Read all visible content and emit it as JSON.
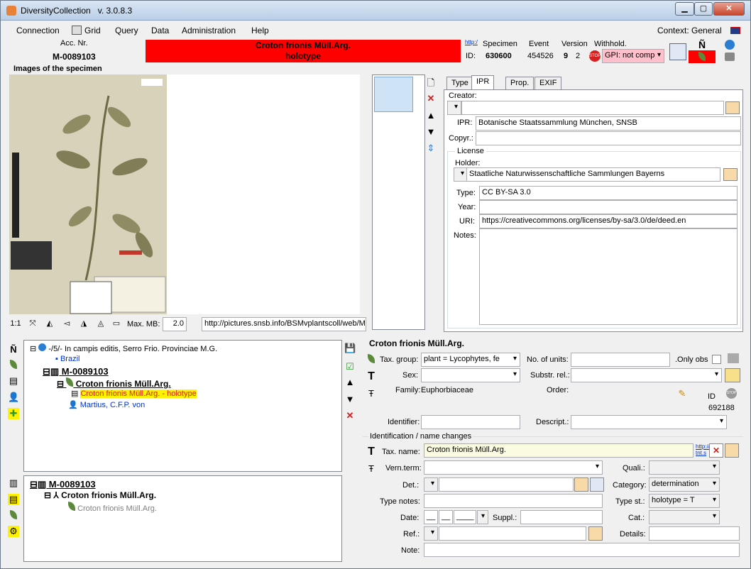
{
  "window": {
    "title": "DiversityCollection",
    "version": "v. 3.0.8.3"
  },
  "menu": {
    "connection": "Connection",
    "grid": "Grid",
    "query": "Query",
    "data": "Data",
    "administration": "Administration",
    "help": "Help",
    "context": "Context: General"
  },
  "header": {
    "acc_label": "Acc. Nr.",
    "acc_value": "M-0089103",
    "banner_line1": "Croton frionis Müll.Arg.",
    "banner_line2": "holotype",
    "http": "http:/",
    "id_label": "ID:",
    "specimen_label": "Specimen",
    "specimen_id": "630600",
    "event_label": "Event",
    "event_id": "454526",
    "version_label": "Version",
    "version_a": "9",
    "version_b": "2",
    "withhold_label": "Withhold.",
    "gpi_value": "GPI: not comp",
    "banner_color": "#ff0000"
  },
  "images": {
    "label": "Images of the specimen",
    "maxmb_label": "Max. MB:",
    "maxmb_value": "2.0",
    "url": "http://pictures.snsb.info/BSMvplantscoll/web/M"
  },
  "ipr": {
    "tabs": [
      "Type",
      "IPR",
      "Prop.",
      "EXIF"
    ],
    "creator_label": "Creator:",
    "creator_value": "",
    "ipr_label": "IPR:",
    "ipr_value": "Botanische Staatssammlung München, SNSB",
    "copyr_label": "Copyr.:",
    "copyr_value": "",
    "license_group": "License",
    "holder_label": "Holder:",
    "holder_value": "Staatliche Naturwissenschaftliche Sammlungen Bayerns",
    "type_label": "Type:",
    "type_value": "CC BY-SA 3.0",
    "year_label": "Year:",
    "year_value": "",
    "uri_label": "URI:",
    "uri_value": "https://creativecommons.org/licenses/by-sa/3.0/de/deed.en",
    "notes_label": "Notes:"
  },
  "tree1": {
    "event": "-/5/- In campis editis, Serro Frio. Provinciae M.G.",
    "country": "Brazil",
    "acc": "M-0089103",
    "taxon": "Croton frionis Müll.Arg.",
    "ident": "Croton frionis Müll.Arg. - holotype",
    "collector": "Martius, C.F.P. von"
  },
  "tree2": {
    "acc": "M-0089103",
    "taxon": "Croton frionis Müll.Arg.",
    "sub": "Croton frionis Müll.Arg."
  },
  "unit": {
    "title": "Croton frionis Müll.Arg.",
    "taxgroup_label": "Tax. group:",
    "taxgroup_value": "plant      = Lycophytes, fe",
    "nunits_label": "No. of units:",
    "onlyobs_label": ".Only obs",
    "sex_label": "Sex:",
    "substr_label": "Substr. rel.:",
    "family_label": "Family:",
    "family_value": "Euphorbiaceae",
    "order_label": "Order:",
    "id_label": "ID",
    "id_value": "692188",
    "identifier_label": "Identifier:",
    "descript_label": "Descript.:"
  },
  "ident": {
    "group": "Identification / name changes",
    "taxname_label": "Tax. name:",
    "taxname_value": "Croton frionis Müll.Arg.",
    "http": "http://",
    "http2": "tnt.s",
    "vern_label": "Vern.term:",
    "quali_label": "Quali.:",
    "det_label": "Det.:",
    "category_label": "Category:",
    "category_value": "determination",
    "typenotes_label": "Type notes:",
    "typest_label": "Type st.:",
    "typest_value": "holotype       = T",
    "date_label": "Date:",
    "date_d": "__",
    "date_m": "__",
    "date_y": "____",
    "suppl_label": "Suppl.:",
    "cat_label": "Cat.:",
    "ref_label": "Ref.:",
    "details_label": "Details:",
    "note_label": "Note:"
  }
}
